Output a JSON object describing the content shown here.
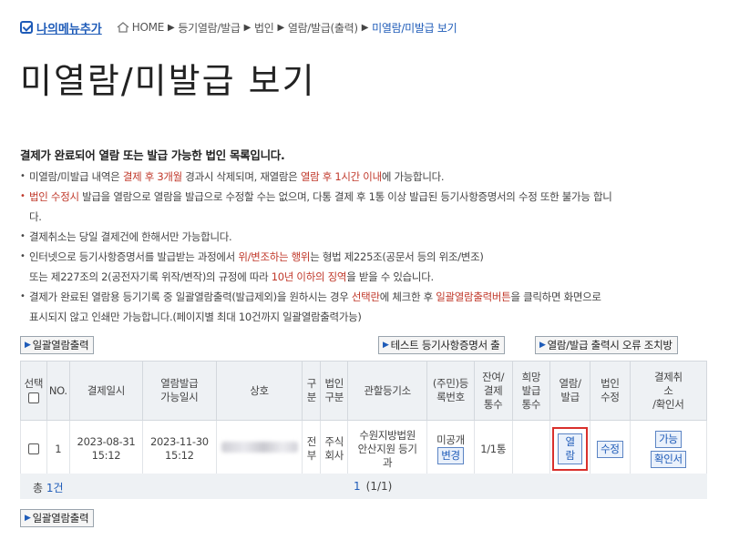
{
  "header": {
    "my_menu_label": "나의메뉴추가",
    "breadcrumb": [
      "HOME",
      "등기열람/발급",
      "법인",
      "열람/발급(출력)",
      "미열람/미발급 보기"
    ],
    "icons": {
      "check": "checkbox-check-icon",
      "home": "home-icon",
      "arrow": "triangle-right-icon"
    }
  },
  "page_title": "미열람/미발급 보기",
  "info": {
    "lead": "결제가 완료되어 열람 또는 발급 가능한 법인 목록입니다.",
    "b1": {
      "t1": "미열람/미발급 내역은 ",
      "r1": "결제 후 3개월",
      "t2": " 경과시 삭제되며, 재열람은 ",
      "r2": "열람 후 1시간 이내",
      "t3": "에 가능합니다."
    },
    "b2": {
      "r1": "법인 수정시",
      "t1": " 발급을 열람으로 열람을 발급으로 수정할 수는 없으며, 다통 결제 후 1통 이상 발급된 등기사항증명서의 수정 또한 불가능 합니",
      "t2": "다."
    },
    "b3": "결제취소는 당일 결제건에 한해서만 가능합니다.",
    "b4": {
      "t1": "인터넷으로 등기사항증명서를 발급받는 과정에서 ",
      "r1": "위/변조하는 행위",
      "t2": "는 형법 제225조(공문서 등의 위조/변조)",
      "t3": "또는 제227조의 2(공전자기록 위작/변작)의 규정에 따라 ",
      "r2": "10년 이하의 징역",
      "t4": "을 받을 수 있습니다."
    },
    "b5": {
      "t1": "결제가 완료된 열람용 등기기록 중 일괄열람출력(발급제외)을 원하시는 경우 ",
      "r1": "선택란",
      "t2": "에 체크한 후 ",
      "r2": "일괄열람출력버튼",
      "t3": "을 클릭하면 화면으로",
      "t4": "표시되지 않고 인쇄만 가능합니다.(페이지별 최대 10건까지 일괄열람출력가능)"
    }
  },
  "buttons": {
    "bulk_print": "일괄열람출력",
    "test_cert": "테스트 등기사항증명서 출",
    "error_fix": "열람/발급 출력시 오류 조치방"
  },
  "table": {
    "headers": {
      "select": "선택",
      "no": "NO.",
      "pay_date": "결제일시",
      "avail_date": [
        "열람발급",
        "가능일시"
      ],
      "name": "상호",
      "division": [
        "구",
        "분"
      ],
      "corp_type": [
        "법인",
        "구분"
      ],
      "registry": "관할등기소",
      "reg_no": [
        "(주민)등",
        "록번호"
      ],
      "remaining": [
        "잔여/",
        "결제",
        "통수"
      ],
      "desired": [
        "희망",
        "발급",
        "통수"
      ],
      "view_issue": [
        "열람/",
        "발급"
      ],
      "modify": [
        "법인",
        "수정"
      ],
      "cancel": [
        "결제취",
        "소",
        "/확인서"
      ]
    },
    "rows": [
      {
        "no": "1",
        "pay_date": [
          "2023-08-31",
          "15:12"
        ],
        "avail_date": [
          "2023-11-30",
          "15:12"
        ],
        "division": [
          "전",
          "부"
        ],
        "corp_type": [
          "주식",
          "회사"
        ],
        "registry": [
          "수원지방법원",
          "안산지원 등기",
          "과"
        ],
        "reg_no": "미공개",
        "reg_change_btn": "변경",
        "remaining": "1/1통",
        "desired": "",
        "view_btn": "열람",
        "modify_btn": "수정",
        "cancel_btn": "가능",
        "confirm_btn": "확인서"
      }
    ]
  },
  "footer": {
    "total_prefix": "총 ",
    "total_count": "1건",
    "page_current": "1",
    "page_info": "(1/1)"
  },
  "colors": {
    "accent_blue": "#1e5bb8",
    "highlight_red": "#c0392b",
    "header_bg": "#eef1f4"
  }
}
